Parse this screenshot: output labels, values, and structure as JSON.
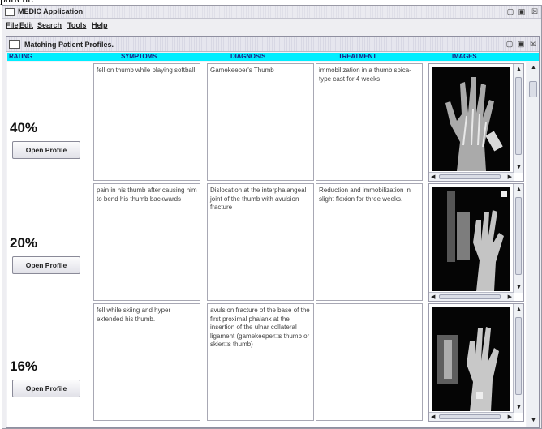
{
  "caption_fragment": "patient.",
  "app": {
    "title": "MEDIC Application",
    "window_controls": [
      "▢",
      "▣",
      "☒"
    ]
  },
  "menu": [
    {
      "label": "File"
    },
    {
      "label": "Edit"
    },
    {
      "label": "Search"
    },
    {
      "label": "Tools"
    },
    {
      "label": "Help"
    }
  ],
  "frame": {
    "title": "Matching Patient Profiles.",
    "window_controls": [
      "▢",
      "▣",
      "☒"
    ]
  },
  "columns": [
    "RATING",
    "SYMPTOMS",
    "DIAGNOSIS",
    "TREATMENT",
    "IMAGES"
  ],
  "header_color": "#00eeff",
  "open_profile_label": "Open Profile",
  "profiles": [
    {
      "rating": "40%",
      "symptoms": "fell on thumb while playing softball.",
      "diagnosis": "Gamekeeper's Thumb",
      "treatment": "immobilization in a thumb spica-type cast for 4 weeks",
      "image": "xray-hand-single"
    },
    {
      "rating": "20%",
      "symptoms": "pain in his thumb after causing him to bend his thumb backwards",
      "diagnosis": "Dislocation at the interphalangeal joint of the thumb with avulsion fracture",
      "treatment": "Reduction and immobilization in slight flexion for three weeks.",
      "image": "xray-hand-multi"
    },
    {
      "rating": "16%",
      "symptoms": "fell while skiing and hyper extended his thumb.",
      "diagnosis": "avulsion fracture of the base of the first proximal phalanx at the insertion of the ulnar collateral ligament (gamekeeper□s thumb or skier□s thumb)",
      "treatment": "",
      "image": "xray-hand-multi"
    }
  ]
}
